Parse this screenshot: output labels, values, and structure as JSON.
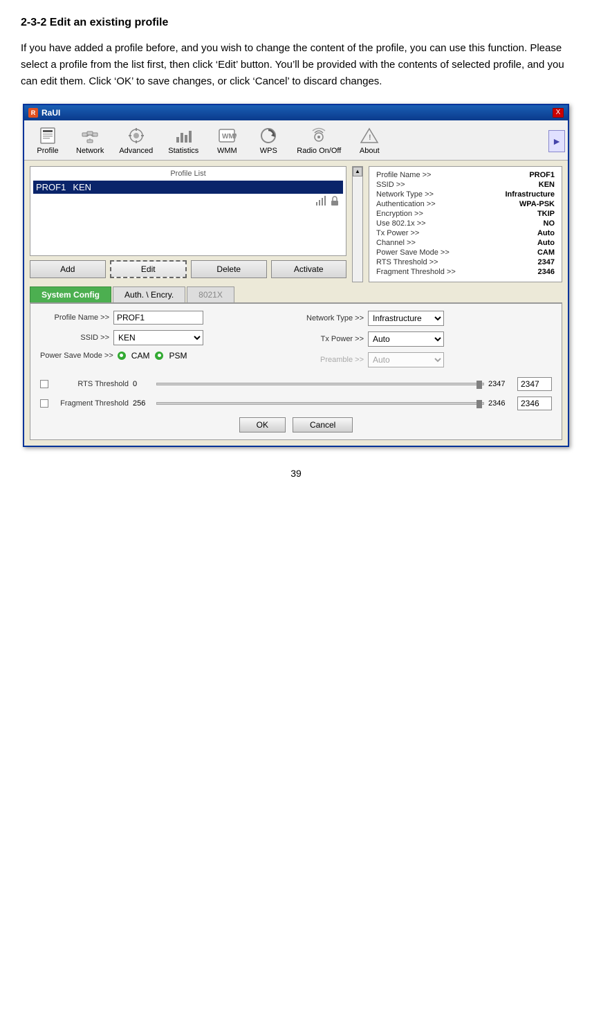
{
  "heading": "2-3-2 Edit an existing profile",
  "body_text": "If you have added a profile before, and you wish to change the content of the profile, you can use this function. Please select a profile from the list first, then click ‘Edit’ button. You’ll be provided with the contents of selected profile, and you can edit them. Click ‘OK’ to save changes, or click ‘Cancel’ to discard changes.",
  "window": {
    "title": "RaUI",
    "close_label": "X"
  },
  "toolbar": {
    "items": [
      {
        "id": "profile",
        "label": "Profile"
      },
      {
        "id": "network",
        "label": "Network"
      },
      {
        "id": "advanced",
        "label": "Advanced"
      },
      {
        "id": "statistics",
        "label": "Statistics"
      },
      {
        "id": "wmm",
        "label": "WMM"
      },
      {
        "id": "wps",
        "label": "WPS"
      },
      {
        "id": "radio-on-off",
        "label": "Radio On/Off"
      },
      {
        "id": "about",
        "label": "About"
      }
    ]
  },
  "profile_list": {
    "title": "Profile List",
    "columns": [
      "Name",
      "SSID"
    ],
    "rows": [
      {
        "name": "PROF1",
        "ssid": "KEN",
        "selected": true
      }
    ]
  },
  "profile_detail": {
    "items": [
      {
        "label": "Profile Name >>",
        "value": "PROF1"
      },
      {
        "label": "SSID >>",
        "value": "KEN"
      },
      {
        "label": "Network Type >>",
        "value": "Infrastructure"
      },
      {
        "label": "Authentication >>",
        "value": "WPA-PSK"
      },
      {
        "label": "Encryption >>",
        "value": "TKIP"
      },
      {
        "label": "Use 802.1x >>",
        "value": "NO"
      },
      {
        "label": "Tx Power >>",
        "value": "Auto"
      },
      {
        "label": "Channel >>",
        "value": "Auto"
      },
      {
        "label": "Power Save Mode >>",
        "value": "CAM"
      },
      {
        "label": "RTS Threshold >>",
        "value": "2347"
      },
      {
        "label": "Fragment Threshold >>",
        "value": "2346"
      }
    ]
  },
  "action_buttons": {
    "add": "Add",
    "edit": "Edit",
    "delete": "Delete",
    "activate": "Activate"
  },
  "tabs": {
    "system_config": "System Config",
    "auth_encry": "Auth. \\ Encry.",
    "dot8021x": "8021X"
  },
  "config_form": {
    "profile_name_label": "Profile Name >>",
    "profile_name_value": "PROF1",
    "ssid_label": "SSID >>",
    "ssid_value": "KEN",
    "power_save_label": "Power Save Mode >>",
    "cam_label": "CAM",
    "psm_label": "PSM",
    "network_type_label": "Network Type >>",
    "network_type_value": "Infrastructure",
    "tx_power_label": "Tx Power >>",
    "tx_power_value": "Auto",
    "preamble_label": "Preamble >>",
    "preamble_value": "Auto",
    "rts_threshold_label": "RTS Threshold",
    "rts_threshold_min": "0",
    "rts_threshold_max": "2347",
    "rts_threshold_value": "2347",
    "fragment_threshold_label": "Fragment Threshold",
    "fragment_threshold_min": "256",
    "fragment_threshold_max": "2346",
    "fragment_threshold_value": "2346",
    "ok_label": "OK",
    "cancel_label": "Cancel"
  },
  "page_number": "39"
}
